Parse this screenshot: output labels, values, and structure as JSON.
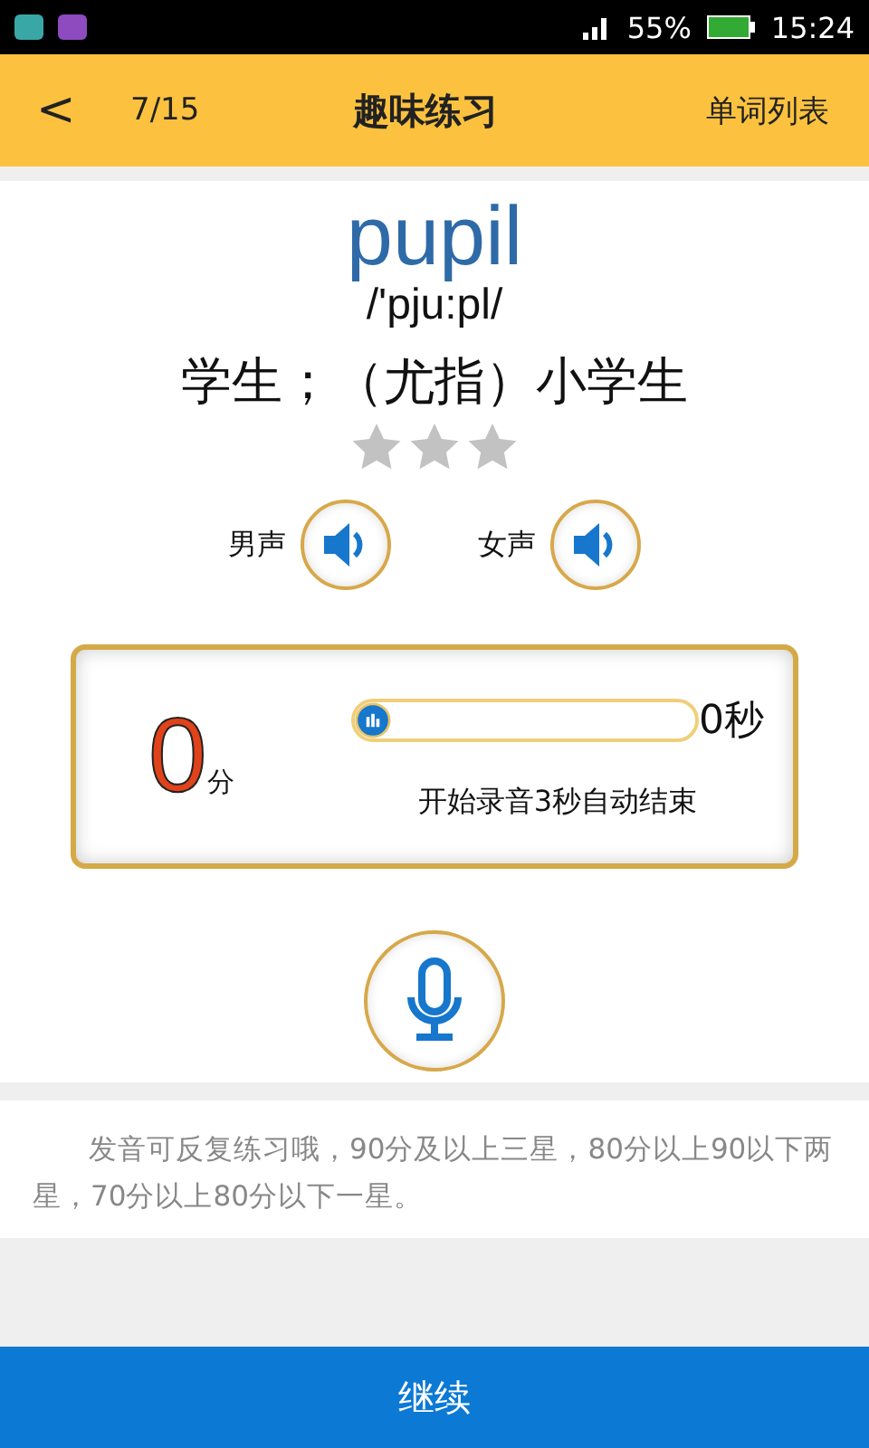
{
  "status_bar": {
    "battery": "55%",
    "time": "15:24"
  },
  "header": {
    "back": "<",
    "progress": "7/15",
    "title": "趣味练习",
    "word_list": "单词列表"
  },
  "word": {
    "text": "pupil",
    "phonetic": "/'pju:pl/",
    "meaning": "学生；（尤指）小学生",
    "stars": 0
  },
  "voices": [
    {
      "label": "男声"
    },
    {
      "label": "女声"
    }
  ],
  "recorder": {
    "score": "0",
    "score_unit": "分",
    "level": 0,
    "seconds": "0秒",
    "hint": "开始录音3秒自动结束"
  },
  "note": "发音可反复练习哦，90分及以上三星，80分以上90以下两星，70分以上80分以下一星。",
  "continue_button": "继续"
}
